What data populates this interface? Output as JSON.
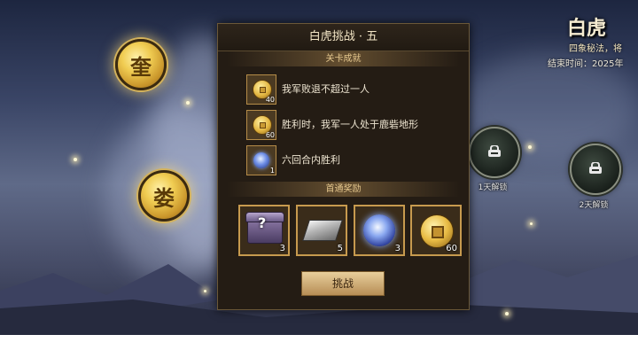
{
  "event": {
    "title": "白虎",
    "subtitle": "四象秘法，将",
    "end_time": "结束时间：2025年"
  },
  "stage_nodes": [
    {
      "char": "奎",
      "state": "available"
    },
    {
      "char": "娄",
      "state": "available"
    }
  ],
  "locked_nodes": [
    {
      "label": "1天解锁",
      "icon": "lock-icon"
    },
    {
      "label": "2天解锁",
      "icon": "lock-icon"
    }
  ],
  "panel": {
    "title": "白虎挑战 · 五",
    "achievements_header": "关卡成就",
    "achievements": [
      {
        "icon": "coin-icon",
        "qty": "40",
        "text": "我军败退不超过一人"
      },
      {
        "icon": "coin-icon",
        "qty": "60",
        "text": "胜利时，我军一人处于鹿砦地形"
      },
      {
        "icon": "orb-icon",
        "qty": "1",
        "text": "六回合内胜利"
      }
    ],
    "rewards_header": "首通奖励",
    "rewards": [
      {
        "icon": "mystery-chest-icon",
        "qty": "3"
      },
      {
        "icon": "silver-bar-icon",
        "qty": "5"
      },
      {
        "icon": "blue-orb-icon",
        "qty": "3"
      },
      {
        "icon": "gold-coin-icon",
        "qty": "60"
      }
    ],
    "challenge_label": "挑战"
  }
}
